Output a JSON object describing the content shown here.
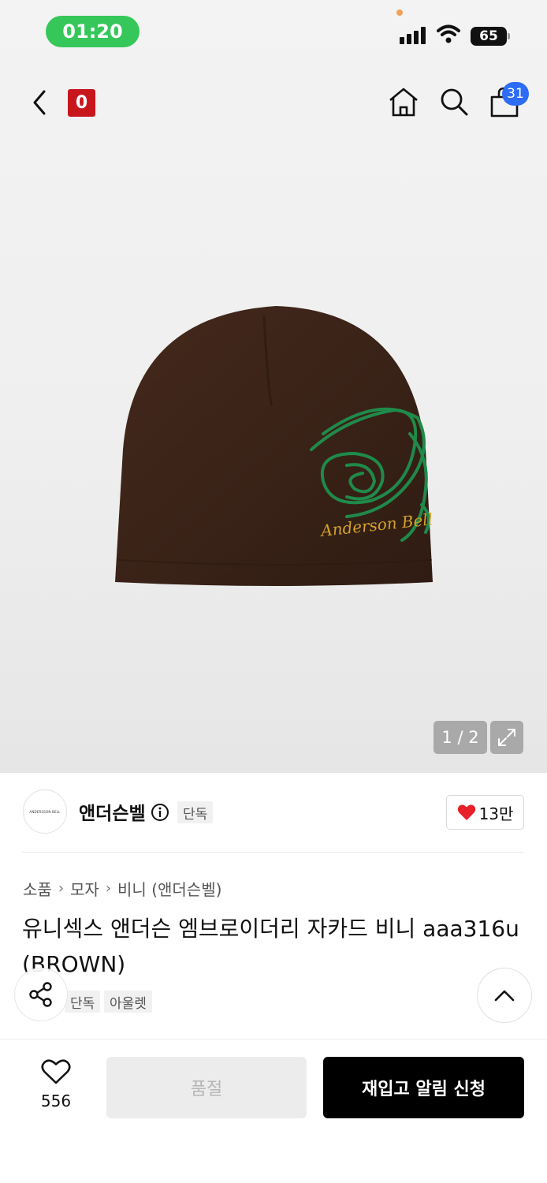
{
  "status_bar": {
    "time": "01:20",
    "battery": "65"
  },
  "nav": {
    "logo_text": "0",
    "cart_count": "31"
  },
  "gallery": {
    "counter": "1 / 2"
  },
  "brand": {
    "logo_text": "ANDERSSON BELL",
    "name": "앤더슨벨",
    "tag": "단독",
    "likes": "13만"
  },
  "breadcrumb": [
    "소품",
    "모자",
    "비니 (앤더슨벨)"
  ],
  "product": {
    "title": "유니섹스 앤더슨 엠브로이더리 자카드 비니 aaa316u(BROWN)",
    "tags": [
      "단독",
      "아울렛"
    ]
  },
  "bottom": {
    "wish_count": "556",
    "soldout_label": "품절",
    "restock_label": "재입고 알림 신청"
  },
  "colors": {
    "accent_green": "#35c759",
    "badge_blue": "#2c6cf6",
    "logo_red": "#c8161d",
    "beanie_brown": "#3b2418"
  }
}
